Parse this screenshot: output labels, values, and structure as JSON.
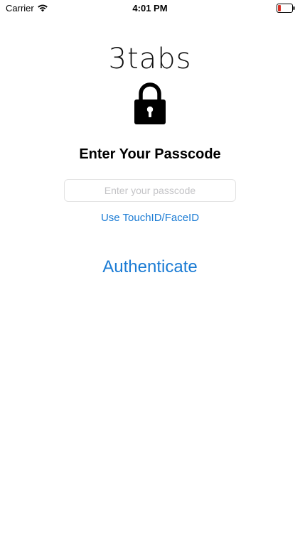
{
  "status_bar": {
    "carrier": "Carrier",
    "time": "4:01 PM",
    "wifi_icon": "wifi-icon",
    "battery_icon": "battery-low-icon"
  },
  "app": {
    "logo_text": "3tabs",
    "lock_icon": "padlock-icon"
  },
  "auth": {
    "title": "Enter Your Passcode",
    "passcode_placeholder": "Enter your passcode",
    "passcode_value": "",
    "touchid_label": "Use TouchID/FaceID",
    "authenticate_label": "Authenticate"
  },
  "colors": {
    "accent": "#1a7bd4",
    "text": "#000000",
    "placeholder": "#c4c4c7",
    "border": "#e3e3e3",
    "battery_level": "#d93025"
  }
}
